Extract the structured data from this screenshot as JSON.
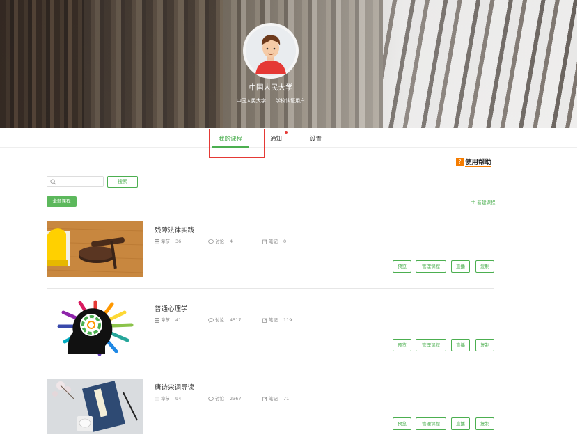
{
  "profile": {
    "name": "中国人民大学",
    "school": "中国人民大学",
    "role": "学校认证用户"
  },
  "tabs": [
    {
      "label": "我的课程",
      "active": true
    },
    {
      "label": "通知",
      "has_dot": true
    },
    {
      "label": "设置"
    }
  ],
  "help": {
    "label": "使用帮助"
  },
  "search": {
    "placeholder": "",
    "value": "",
    "button": "搜索"
  },
  "filters": {
    "all_courses": "全部课程",
    "new_course": "新建课程",
    "new_course_icon": "+"
  },
  "stat_labels": {
    "chapters": "章节",
    "discussions": "讨论",
    "notes": "笔记"
  },
  "courses": [
    {
      "title": "残障法律实践",
      "chapters": "36",
      "discussions": "4",
      "notes": "0"
    },
    {
      "title": "普通心理学",
      "chapters": "41",
      "discussions": "4517",
      "notes": "119"
    },
    {
      "title": "唐诗宋词导读",
      "chapters": "94",
      "discussions": "2367",
      "notes": "71"
    }
  ],
  "course_actions": {
    "preview": "预览",
    "manage": "管理课程",
    "live": "直播",
    "copy": "复制"
  },
  "colors": {
    "accent": "#4caf50",
    "highlight": "#e53935",
    "help": "#f57c00"
  }
}
